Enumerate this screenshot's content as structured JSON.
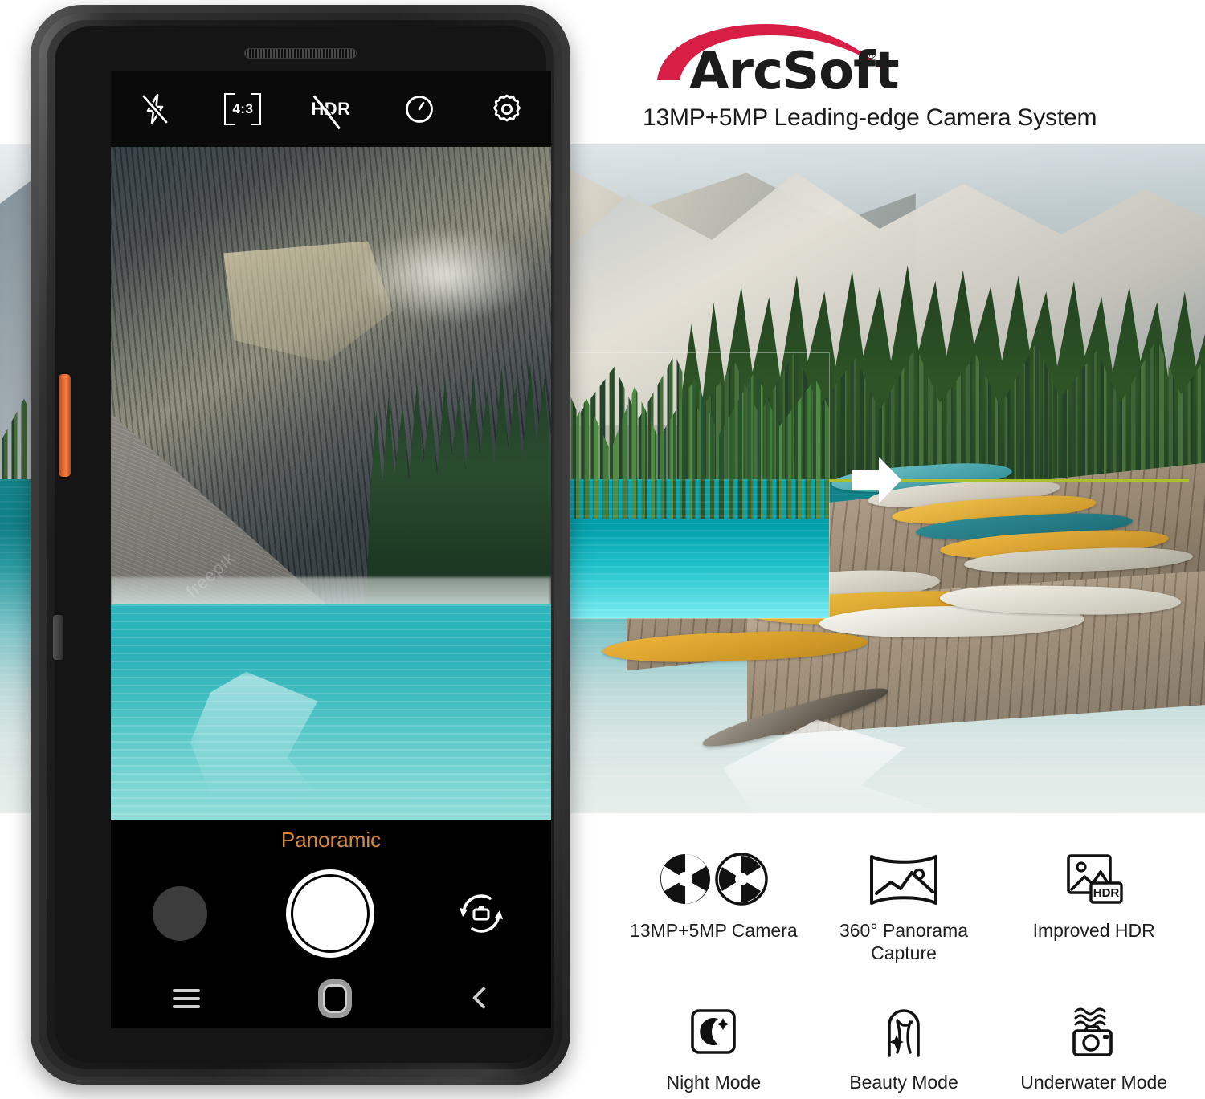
{
  "brand": {
    "logo_text": "ArcSoft",
    "registered_mark": "®",
    "tagline": "13MP+5MP Leading-edge Camera System",
    "accent_color": "#d81e45"
  },
  "phone": {
    "hardware": {
      "earpiece": "earpiece-grille",
      "front_camera": "front-camera-lens",
      "orange_button": "custom-function-button",
      "volume_button": "volume-rocker",
      "power_button": "power-button"
    },
    "camera_ui": {
      "top_bar": [
        {
          "name": "flash-off-icon",
          "label": "Flash Off",
          "state": "off"
        },
        {
          "name": "aspect-ratio-button",
          "label": "4:3",
          "state": "4:3"
        },
        {
          "name": "hdr-off-icon",
          "label": "HDR",
          "state": "off"
        },
        {
          "name": "timer-icon",
          "label": "Timer",
          "state": "off"
        },
        {
          "name": "settings-gear-icon",
          "label": "Settings",
          "state": ""
        }
      ],
      "mode_label": "Panoramic",
      "mode_label_color": "#d8883e",
      "controls": [
        {
          "name": "gallery-thumbnail-button",
          "label": "Gallery"
        },
        {
          "name": "shutter-button",
          "label": "Shutter"
        },
        {
          "name": "switch-camera-button",
          "label": "Switch Camera"
        }
      ],
      "nav_bar": [
        {
          "name": "nav-menu-button",
          "label": "Menu"
        },
        {
          "name": "nav-home-button",
          "label": "Home"
        },
        {
          "name": "nav-back-button",
          "label": "Back"
        }
      ],
      "viewfinder_watermark": "freepik"
    }
  },
  "panorama": {
    "guide_line_color": "#aebf2e",
    "arrow": "pan-direction-arrow",
    "captured_tile": "captured-panorama-tile"
  },
  "features": {
    "row1": [
      {
        "icon": "dual-aperture-icon",
        "label": "13MP+5MP Camera"
      },
      {
        "icon": "panorama-icon",
        "label": "360° Panorama\nCapture",
        "line1": "360° Panorama",
        "line2": "Capture"
      },
      {
        "icon": "hdr-photo-icon",
        "label": "Improved HDR",
        "badge": "HDR"
      }
    ],
    "row2": [
      {
        "icon": "night-mode-icon",
        "label": "Night Mode"
      },
      {
        "icon": "beauty-mode-icon",
        "label": "Beauty Mode"
      },
      {
        "icon": "underwater-mode-icon",
        "label": "Underwater Mode"
      }
    ]
  }
}
